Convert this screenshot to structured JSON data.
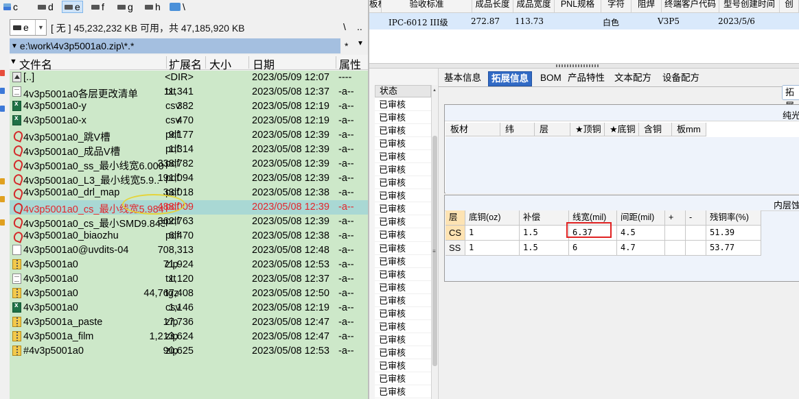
{
  "drives": [
    {
      "label": "c",
      "active": false
    },
    {
      "label": "d",
      "active": false
    },
    {
      "label": "e",
      "active": true
    },
    {
      "label": "f",
      "active": false
    },
    {
      "label": "g",
      "active": false
    },
    {
      "label": "h",
      "active": false
    },
    {
      "label": "\\",
      "active": false
    }
  ],
  "drive_select": {
    "value": "e"
  },
  "disk_info": "[ 无 ]  45,232,232 KB 可用，共 47,185,920 KB",
  "root_button": "\\",
  "up_button": "..",
  "path": "e:\\work\\4v3p5001a0.zip\\*.*",
  "history_button": "*",
  "columns": {
    "name": "文件名",
    "ext": "扩展名",
    "size": "大小",
    "date": "日期",
    "attr": "属性"
  },
  "files": [
    {
      "icon": "up",
      "name": "[..]",
      "ext": "",
      "size": "<DIR>",
      "date": "2023/05/09 12:07",
      "attr": "----"
    },
    {
      "icon": "txt",
      "name": "4v3p5001a0各层更改清单",
      "ext": "txt",
      "size": "11,341",
      "date": "2023/05/08 12:37",
      "attr": "-a--"
    },
    {
      "icon": "csv",
      "name": "4v3p5001a0-y",
      "ext": "csv",
      "size": "382",
      "date": "2023/05/08 12:19",
      "attr": "-a--"
    },
    {
      "icon": "csv",
      "name": "4v3p5001a0-x",
      "ext": "csv",
      "size": "470",
      "date": "2023/05/08 12:19",
      "attr": "-a--"
    },
    {
      "icon": "pdf",
      "name": "4v3p5001a0_跳V槽",
      "ext": "pdf",
      "size": "9,177",
      "date": "2023/05/08 12:39",
      "attr": "-a--"
    },
    {
      "icon": "pdf",
      "name": "4v3p5001a0_成品V槽",
      "ext": "pdf",
      "size": "1,314",
      "date": "2023/05/08 12:39",
      "attr": "-a--"
    },
    {
      "icon": "pdf",
      "name": "4v3p5001a0_ss_最小线宽6.000",
      "ext": "pdf",
      "size": "338,782",
      "date": "2023/05/08 12:39",
      "attr": "-a--"
    },
    {
      "icon": "pdf",
      "name": "4v3p5001a0_L3_最小线宽5.9..",
      "ext": "pdf",
      "size": "191,094",
      "date": "2023/05/08 12:39",
      "attr": "-a--"
    },
    {
      "icon": "pdf",
      "name": "4v3p5001a0_drl_map",
      "ext": "pdf",
      "size": "33,018",
      "date": "2023/05/08 12:38",
      "attr": "-a--"
    },
    {
      "icon": "pdf",
      "name": "4v3p5001a0_cs_最小线宽5.984",
      "ext": "pdf",
      "size": "488,009",
      "date": "2023/05/08 12:39",
      "attr": "-a--",
      "selected": true
    },
    {
      "icon": "pdf",
      "name": "4v3p5001a0_cs_最小SMD9.843",
      "ext": "pdf",
      "size": "362,763",
      "date": "2023/05/08 12:39",
      "attr": "-a--"
    },
    {
      "icon": "pdf",
      "name": "4v3p5001a0_biaozhu",
      "ext": "pdf",
      "size": "6,470",
      "date": "2023/05/08 12:38",
      "attr": "-a--"
    },
    {
      "icon": "gen",
      "name": "4v3p5001a0@uvdits-04",
      "ext": "",
      "size": "708,313",
      "date": "2023/05/08 12:48",
      "attr": "-a--"
    },
    {
      "icon": "zip",
      "name": "4v3p5001a0",
      "ext": "zip",
      "size": "71,924",
      "date": "2023/05/08 12:53",
      "attr": "-a--"
    },
    {
      "icon": "txt",
      "name": "4v3p5001a0",
      "ext": "txt",
      "size": "1,120",
      "date": "2023/05/08 12:37",
      "attr": "-a--"
    },
    {
      "icon": "zip",
      "name": "4v3p5001a0",
      "ext": "tgz",
      "size": "44,767,408",
      "date": "2023/05/08 12:50",
      "attr": "-a--"
    },
    {
      "icon": "csv",
      "name": "4v3p5001a0",
      "ext": "csv",
      "size": "1,146",
      "date": "2023/05/08 12:19",
      "attr": "-a--"
    },
    {
      "icon": "zip",
      "name": "4v3p5001a_paste",
      "ext": "zip",
      "size": "17,736",
      "date": "2023/05/08 12:47",
      "attr": "-a--"
    },
    {
      "icon": "zip",
      "name": "4v3p5001a_film",
      "ext": "zip",
      "size": "1,213,624",
      "date": "2023/05/08 12:47",
      "attr": "-a--"
    },
    {
      "icon": "zip",
      "name": "#4v3p5001a0",
      "ext": "zip",
      "size": "90,625",
      "date": "2023/05/08 12:53",
      "attr": "-a--"
    }
  ],
  "top_grid": {
    "headers": [
      "板材",
      "验收标准",
      "成品长度",
      "成品宽度",
      "PNL规格",
      "字符",
      "阻焊",
      "终端客户代码",
      "型号创建时间",
      "创"
    ],
    "row": [
      "",
      "IPC-6012 III级",
      "272.87",
      "113.73",
      "",
      "白色",
      "",
      "V3P5",
      "2023/5/6",
      ""
    ]
  },
  "status_column": {
    "header": "状态",
    "value": "已审核",
    "count": 23
  },
  "tabs": [
    {
      "label": "基本信息",
      "active": false
    },
    {
      "label": "拓展信息",
      "active": true
    },
    {
      "label": "BOM",
      "active": false
    },
    {
      "label": "产品特性",
      "active": false
    },
    {
      "label": "文本配方",
      "active": false
    },
    {
      "label": "设备配方",
      "active": false
    }
  ],
  "side_button": "拓展",
  "panel1": {
    "title": "纯光",
    "columns": [
      "板材",
      "纬",
      "层",
      "★顶铜",
      "★底铜",
      "含铜",
      "板mm"
    ]
  },
  "panel2": {
    "title": "内层蚀",
    "columns": [
      "层",
      "底铜(oz)",
      "补偿",
      "线宽(mil)",
      "间距(mil)",
      "+",
      "-",
      "残铜率(%)"
    ],
    "rows": [
      {
        "layer": "CS",
        "base_copper": "1",
        "compensation": "1.5",
        "line_width": "6.37",
        "spacing": "4.5",
        "plus": "",
        "minus": "",
        "residual": "51.39"
      },
      {
        "layer": "SS",
        "base_copper": "1",
        "compensation": "1.5",
        "line_width": "6",
        "spacing": "4.7",
        "plus": "",
        "minus": "",
        "residual": "53.77"
      }
    ]
  }
}
